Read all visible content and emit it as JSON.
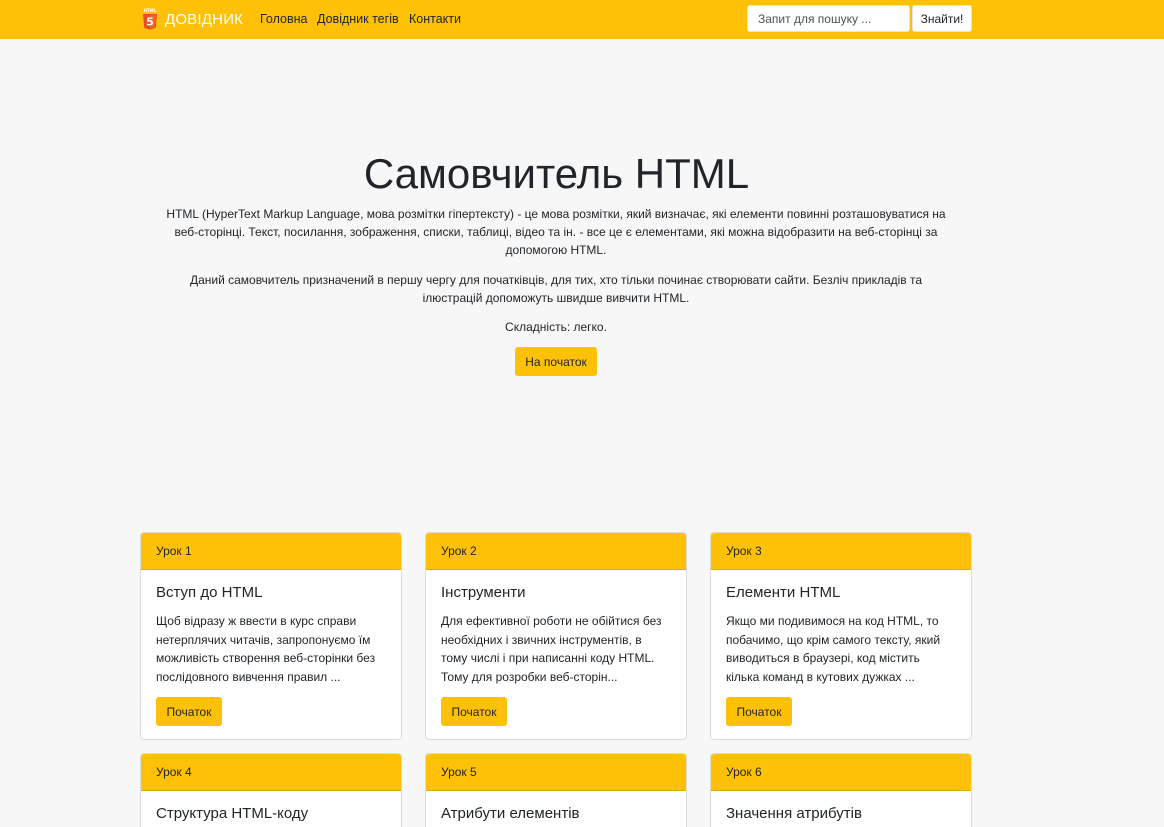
{
  "navbar": {
    "brand": "ДОВІДНИК",
    "logo_label": "HTML",
    "logo_number": "5",
    "links": [
      "Головна",
      "Довідник тегів",
      "Контакти"
    ],
    "search_placeholder": "Запит для пошуку ...",
    "search_button": "Знайти!"
  },
  "hero": {
    "title": "Самовчитель HTML",
    "paragraph1": "HTML (HyperText Markup Language, мова розмітки гіпертексту) - це мова розмітки, який визначає, які елементи повинні розташовуватися на веб-сторінці. Текст, посилання, зображення, списки, таблиці, відео та ін. - все це є елементами, які можна відобразити на веб-сторінці за допомогою HTML.",
    "paragraph2": "Даний самовчитель призначений в першу чергу для початківців, для тих, хто тільки починає створювати сайти. Безліч прикладів та ілюстрацій допоможуть швидше вивчити HTML.",
    "difficulty": "Складність: легко.",
    "button": "На початок"
  },
  "lessons": [
    {
      "header": "Урок 1",
      "title": "Вступ до HTML",
      "text": "Щоб відразу ж ввести в курс справи нетерплячих читачів, запропонуємо їм можливість створення веб-сторінки без послідовного вивчення правил ...",
      "button": "Початок"
    },
    {
      "header": "Урок 2",
      "title": "Інструменти",
      "text": "Для ефективної роботи не обійтися без необхідних і звичних інструментів, в тому числі і при написанні коду HTML. Тому для розробки веб-сторін...",
      "button": "Початок"
    },
    {
      "header": "Урок 3",
      "title": "Елементи HTML",
      "text": "Якщо ми подивимося на код HTML, то побачимо, що крім самого тексту, який виводиться в браузері, код містить кілька команд в кутових дужках ...",
      "button": "Початок"
    },
    {
      "header": "Урок 4",
      "title": "Структура HTML-коду"
    },
    {
      "header": "Урок 5",
      "title": "Атрибути елементів"
    },
    {
      "header": "Урок 6",
      "title": "Значення атрибутів"
    }
  ],
  "colors": {
    "accent": "#ffc107",
    "background": "#f7f7f7",
    "logo": "#e44d26"
  }
}
